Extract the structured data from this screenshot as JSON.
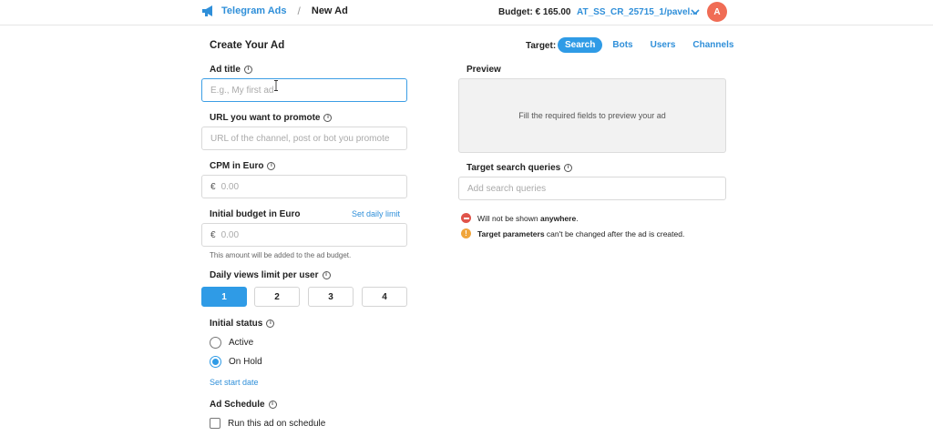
{
  "header": {
    "brand": "Telegram Ads",
    "separator": "/",
    "current": "New Ad",
    "budget": "Budget: € 165.00",
    "account": "AT_SS_CR_25715_1/pavel...",
    "avatar_letter": "A"
  },
  "page": {
    "title": "Create Your Ad",
    "target_label": "Target:",
    "target_tabs": [
      "Search",
      "Bots",
      "Users",
      "Channels"
    ],
    "active_target": "Search"
  },
  "form": {
    "ad_title": {
      "label": "Ad title",
      "placeholder": "E.g., My first ad",
      "value": ""
    },
    "url": {
      "label": "URL you want to promote",
      "placeholder": "URL of the channel, post or bot you promote",
      "value": ""
    },
    "cpm": {
      "label": "CPM in Euro",
      "currency": "€",
      "placeholder": "0.00"
    },
    "budget": {
      "label": "Initial budget in Euro",
      "daily_link": "Set daily limit",
      "currency": "€",
      "placeholder": "0.00",
      "helper": "This amount will be added to the ad budget."
    },
    "views_limit": {
      "label": "Daily views limit per user",
      "options": [
        "1",
        "2",
        "3",
        "4"
      ],
      "selected": "1"
    },
    "status": {
      "label": "Initial status",
      "options": [
        "Active",
        "On Hold"
      ],
      "selected": "On Hold",
      "start_link": "Set start date"
    },
    "schedule": {
      "label": "Ad Schedule",
      "checkbox_label": "Run this ad on schedule",
      "checked": false
    }
  },
  "preview": {
    "label": "Preview",
    "placeholder": "Fill the required fields to preview your ad"
  },
  "queries": {
    "label": "Target search queries",
    "placeholder": "Add search queries"
  },
  "notices": [
    {
      "type": "error",
      "color": "#e0544a",
      "pre": "Will not be shown ",
      "bold": "anywhere",
      "post": "."
    },
    {
      "type": "warning",
      "color": "#f0a53b",
      "pre": "",
      "bold": "Target parameters",
      "post": " can't be changed after the ad is created."
    }
  ],
  "colors": {
    "accent": "#2f9be6",
    "link": "#2f8fd9",
    "avatar": "#f06c55"
  }
}
